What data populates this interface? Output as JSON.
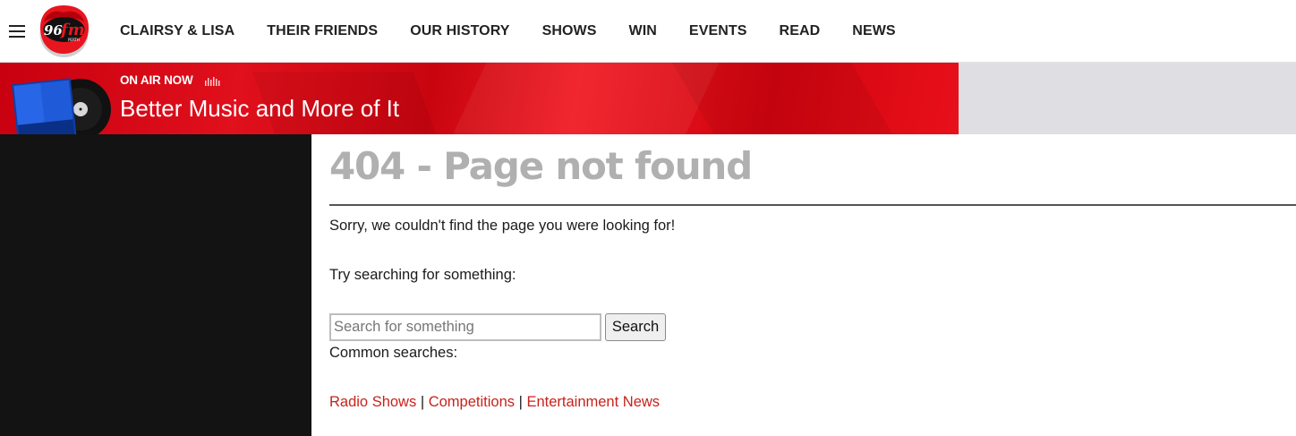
{
  "header": {
    "logo": {
      "number": "96",
      "suffix": "fm",
      "city": "PERTH"
    },
    "nav": [
      "CLAIRSY & LISA",
      "THEIR FRIENDS",
      "OUR HISTORY",
      "SHOWS",
      "WIN",
      "EVENTS",
      "READ",
      "NEWS"
    ]
  },
  "onair": {
    "label": "ON AIR NOW",
    "title": "Better Music and More of It"
  },
  "content": {
    "title": "404 - Page not found",
    "sorry": "Sorry, we couldn't find the page you were looking for!",
    "try": "Try searching for something:",
    "search": {
      "placeholder": "Search for something",
      "value": "",
      "button": "Search"
    },
    "common": "Common searches:",
    "links": [
      "Radio Shows",
      "Competitions",
      "Entertainment News"
    ],
    "separator": "|"
  },
  "colors": {
    "accent": "#e0101c",
    "link": "#c8221c",
    "title_grey": "#b0b0b0"
  }
}
